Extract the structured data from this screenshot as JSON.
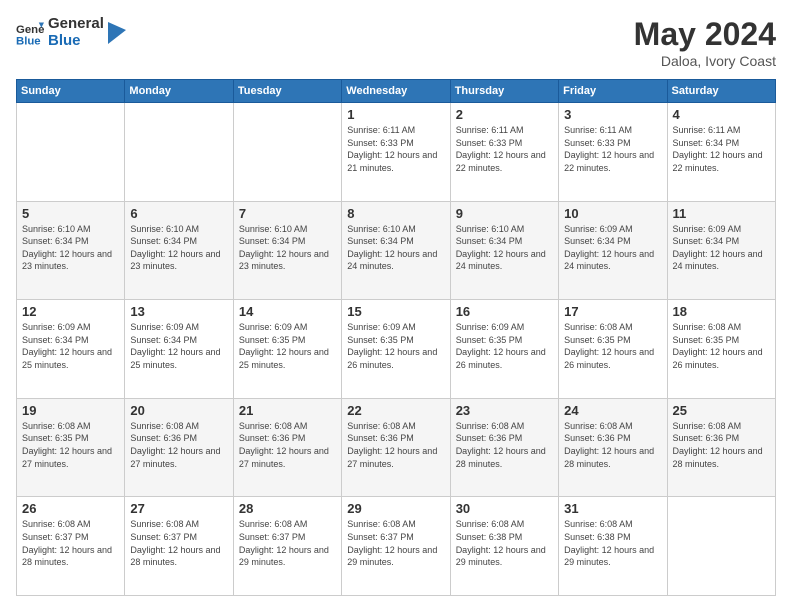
{
  "logo": {
    "line1": "General",
    "line2": "Blue"
  },
  "title": "May 2024",
  "subtitle": "Daloa, Ivory Coast",
  "header_days": [
    "Sunday",
    "Monday",
    "Tuesday",
    "Wednesday",
    "Thursday",
    "Friday",
    "Saturday"
  ],
  "weeks": [
    [
      {
        "day": "",
        "info": ""
      },
      {
        "day": "",
        "info": ""
      },
      {
        "day": "",
        "info": ""
      },
      {
        "day": "1",
        "info": "Sunrise: 6:11 AM\nSunset: 6:33 PM\nDaylight: 12 hours and 21 minutes."
      },
      {
        "day": "2",
        "info": "Sunrise: 6:11 AM\nSunset: 6:33 PM\nDaylight: 12 hours and 22 minutes."
      },
      {
        "day": "3",
        "info": "Sunrise: 6:11 AM\nSunset: 6:33 PM\nDaylight: 12 hours and 22 minutes."
      },
      {
        "day": "4",
        "info": "Sunrise: 6:11 AM\nSunset: 6:34 PM\nDaylight: 12 hours and 22 minutes."
      }
    ],
    [
      {
        "day": "5",
        "info": "Sunrise: 6:10 AM\nSunset: 6:34 PM\nDaylight: 12 hours and 23 minutes."
      },
      {
        "day": "6",
        "info": "Sunrise: 6:10 AM\nSunset: 6:34 PM\nDaylight: 12 hours and 23 minutes."
      },
      {
        "day": "7",
        "info": "Sunrise: 6:10 AM\nSunset: 6:34 PM\nDaylight: 12 hours and 23 minutes."
      },
      {
        "day": "8",
        "info": "Sunrise: 6:10 AM\nSunset: 6:34 PM\nDaylight: 12 hours and 24 minutes."
      },
      {
        "day": "9",
        "info": "Sunrise: 6:10 AM\nSunset: 6:34 PM\nDaylight: 12 hours and 24 minutes."
      },
      {
        "day": "10",
        "info": "Sunrise: 6:09 AM\nSunset: 6:34 PM\nDaylight: 12 hours and 24 minutes."
      },
      {
        "day": "11",
        "info": "Sunrise: 6:09 AM\nSunset: 6:34 PM\nDaylight: 12 hours and 24 minutes."
      }
    ],
    [
      {
        "day": "12",
        "info": "Sunrise: 6:09 AM\nSunset: 6:34 PM\nDaylight: 12 hours and 25 minutes."
      },
      {
        "day": "13",
        "info": "Sunrise: 6:09 AM\nSunset: 6:34 PM\nDaylight: 12 hours and 25 minutes."
      },
      {
        "day": "14",
        "info": "Sunrise: 6:09 AM\nSunset: 6:35 PM\nDaylight: 12 hours and 25 minutes."
      },
      {
        "day": "15",
        "info": "Sunrise: 6:09 AM\nSunset: 6:35 PM\nDaylight: 12 hours and 26 minutes."
      },
      {
        "day": "16",
        "info": "Sunrise: 6:09 AM\nSunset: 6:35 PM\nDaylight: 12 hours and 26 minutes."
      },
      {
        "day": "17",
        "info": "Sunrise: 6:08 AM\nSunset: 6:35 PM\nDaylight: 12 hours and 26 minutes."
      },
      {
        "day": "18",
        "info": "Sunrise: 6:08 AM\nSunset: 6:35 PM\nDaylight: 12 hours and 26 minutes."
      }
    ],
    [
      {
        "day": "19",
        "info": "Sunrise: 6:08 AM\nSunset: 6:35 PM\nDaylight: 12 hours and 27 minutes."
      },
      {
        "day": "20",
        "info": "Sunrise: 6:08 AM\nSunset: 6:36 PM\nDaylight: 12 hours and 27 minutes."
      },
      {
        "day": "21",
        "info": "Sunrise: 6:08 AM\nSunset: 6:36 PM\nDaylight: 12 hours and 27 minutes."
      },
      {
        "day": "22",
        "info": "Sunrise: 6:08 AM\nSunset: 6:36 PM\nDaylight: 12 hours and 27 minutes."
      },
      {
        "day": "23",
        "info": "Sunrise: 6:08 AM\nSunset: 6:36 PM\nDaylight: 12 hours and 28 minutes."
      },
      {
        "day": "24",
        "info": "Sunrise: 6:08 AM\nSunset: 6:36 PM\nDaylight: 12 hours and 28 minutes."
      },
      {
        "day": "25",
        "info": "Sunrise: 6:08 AM\nSunset: 6:36 PM\nDaylight: 12 hours and 28 minutes."
      }
    ],
    [
      {
        "day": "26",
        "info": "Sunrise: 6:08 AM\nSunset: 6:37 PM\nDaylight: 12 hours and 28 minutes."
      },
      {
        "day": "27",
        "info": "Sunrise: 6:08 AM\nSunset: 6:37 PM\nDaylight: 12 hours and 28 minutes."
      },
      {
        "day": "28",
        "info": "Sunrise: 6:08 AM\nSunset: 6:37 PM\nDaylight: 12 hours and 29 minutes."
      },
      {
        "day": "29",
        "info": "Sunrise: 6:08 AM\nSunset: 6:37 PM\nDaylight: 12 hours and 29 minutes."
      },
      {
        "day": "30",
        "info": "Sunrise: 6:08 AM\nSunset: 6:38 PM\nDaylight: 12 hours and 29 minutes."
      },
      {
        "day": "31",
        "info": "Sunrise: 6:08 AM\nSunset: 6:38 PM\nDaylight: 12 hours and 29 minutes."
      },
      {
        "day": "",
        "info": ""
      }
    ]
  ]
}
